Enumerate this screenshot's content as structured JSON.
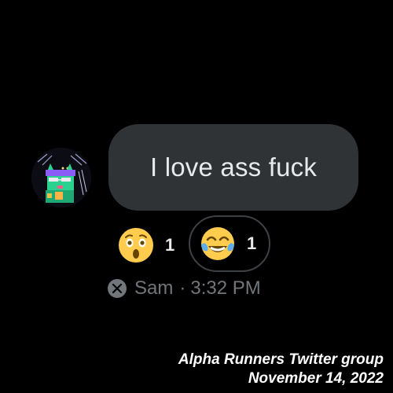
{
  "message": {
    "text": "I love ass fuck",
    "avatar_icon": "pixel-cat-avatar-icon"
  },
  "reactions": [
    {
      "emoji": "astonished-face",
      "count": "1",
      "selected": false
    },
    {
      "emoji": "face-with-tears-of-joy",
      "count": "1",
      "selected": true
    }
  ],
  "meta": {
    "badge_icon": "x-logo-icon",
    "sender": "Sam",
    "separator": "·",
    "time": "3:32 PM"
  },
  "caption": {
    "line1": "Alpha Runners Twitter group",
    "line2": "November 14, 2022"
  },
  "colors": {
    "background": "#000000",
    "bubble": "#2f3336",
    "muted_text": "#71767b",
    "emoji_yellow": "#ffcc4d"
  }
}
